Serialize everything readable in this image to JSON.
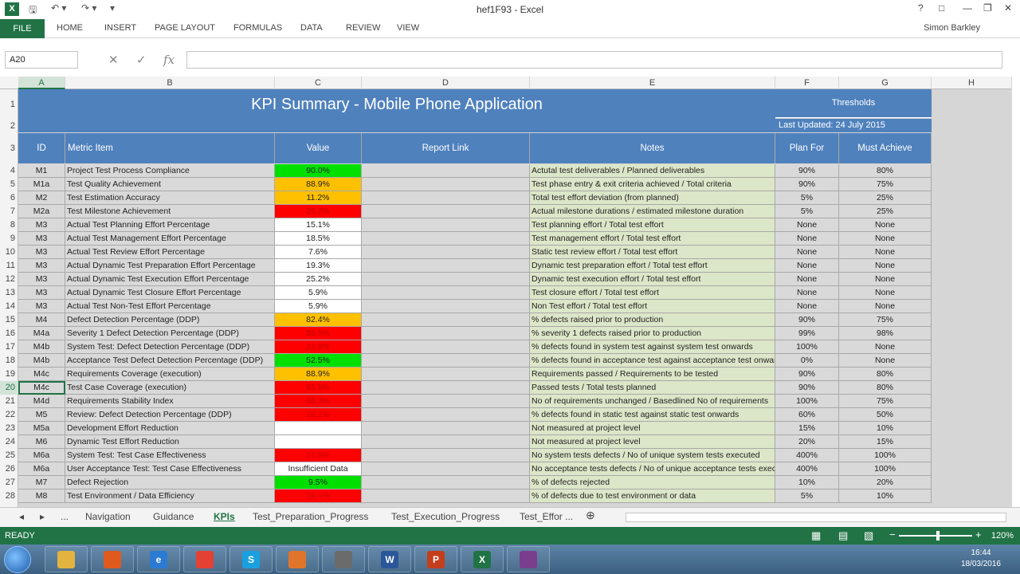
{
  "app": {
    "title": "hef1F93 - Excel",
    "user": "Simon Barkley",
    "help": "?",
    "logo": "X"
  },
  "ribbon": {
    "tabs": [
      "FILE",
      "HOME",
      "INSERT",
      "PAGE LAYOUT",
      "FORMULAS",
      "DATA",
      "REVIEW",
      "VIEW"
    ]
  },
  "formula_bar": {
    "name_box": "A20",
    "fx": "fx",
    "formula": ""
  },
  "columns": [
    "A",
    "B",
    "C",
    "D",
    "E",
    "F",
    "G",
    "H"
  ],
  "sheet_header": {
    "title": "KPI Summary - Mobile Phone Application",
    "thresholds": "Thresholds",
    "last_updated": "Last Updated:  24 July 2015",
    "col_id": "ID",
    "col_metric": "Metric Item",
    "col_value": "Value",
    "col_link": "Report Link",
    "col_notes": "Notes",
    "col_plan": "Plan For",
    "col_must": "Must Achieve"
  },
  "rows": [
    {
      "n": "4",
      "id": "M1",
      "metric": "Project Test Process Compliance",
      "value": "90.0%",
      "status": "green",
      "notes": "Actutal test deliverables / Planned deliverables",
      "plan": "90%",
      "must": "80%"
    },
    {
      "n": "5",
      "id": "M1a",
      "metric": "Test Quality Achievement",
      "value": "88.9%",
      "status": "amber",
      "notes": "Test phase entry & exit criteria achieved / Total criteria",
      "plan": "90%",
      "must": "75%"
    },
    {
      "n": "6",
      "id": "M2",
      "metric": "Test Estimation Accuracy",
      "value": "11.2%",
      "status": "amber",
      "notes": "Total test effort deviation (from planned)",
      "plan": "5%",
      "must": "25%"
    },
    {
      "n": "7",
      "id": "M2a",
      "metric": "Test Milestone Achievement",
      "value": "29.2%",
      "status": "red",
      "notes": "Actual milestone durations / estimated milestone duration",
      "plan": "5%",
      "must": "25%"
    },
    {
      "n": "8",
      "id": "M3",
      "metric": "Actual Test Planning Effort Percentage",
      "value": "15.1%",
      "status": "none",
      "notes": "Test planning effort / Total test effort",
      "plan": "None",
      "must": "None"
    },
    {
      "n": "9",
      "id": "M3",
      "metric": "Actual Test Management Effort Percentage",
      "value": "18.5%",
      "status": "none",
      "notes": "Test management effort / Total test effort",
      "plan": "None",
      "must": "None"
    },
    {
      "n": "10",
      "id": "M3",
      "metric": "Actual Test Review Effort Percentage",
      "value": "7.6%",
      "status": "none",
      "notes": "Static test review effort / Total test effort",
      "plan": "None",
      "must": "None"
    },
    {
      "n": "11",
      "id": "M3",
      "metric": "Actual Dynamic Test Preparation Effort Percentage",
      "value": "19.3%",
      "status": "none",
      "notes": "Dynamic test preparation effort / Total test effort",
      "plan": "None",
      "must": "None"
    },
    {
      "n": "12",
      "id": "M3",
      "metric": "Actual Dynamic Test Execution Effort Percentage",
      "value": "25.2%",
      "status": "none",
      "notes": "Dynamic test execution effort / Total test effort",
      "plan": "None",
      "must": "None"
    },
    {
      "n": "13",
      "id": "M3",
      "metric": "Actual Dynamic Test Closure Effort Percentage",
      "value": "5.9%",
      "status": "none",
      "notes": "Test closure effort / Total test effort",
      "plan": "None",
      "must": "None"
    },
    {
      "n": "14",
      "id": "M3",
      "metric": "Actual Test Non-Test Effort Percentage",
      "value": "5.9%",
      "status": "none",
      "notes": "Non Test effort / Total test effort",
      "plan": "None",
      "must": "None"
    },
    {
      "n": "15",
      "id": "M4",
      "metric": "Defect Detection Percentage (DDP)",
      "value": "82.4%",
      "status": "amber",
      "notes": "% defects raised prior to production",
      "plan": "90%",
      "must": "75%"
    },
    {
      "n": "16",
      "id": "M4a",
      "metric": "Severity 1 Defect Detection Percentage (DDP)",
      "value": "88.9%",
      "status": "red",
      "notes": "% severity 1 defects raised prior to production",
      "plan": "99%",
      "must": "98%"
    },
    {
      "n": "17",
      "id": "M4b",
      "metric": "System Test: Defect Detection Percentage (DDP)",
      "value": "23.9%",
      "status": "red",
      "notes": "% defects found in system test against system test onwards",
      "plan": "100%",
      "must": "None"
    },
    {
      "n": "18",
      "id": "M4b",
      "metric": "Acceptance Test Defect Detection Percentage (DDP)",
      "value": "52.5%",
      "status": "green",
      "notes": "% defects found in acceptance test against acceptance test onwards",
      "plan": "0%",
      "must": "None"
    },
    {
      "n": "19",
      "id": "M4c",
      "metric": "Requirements Coverage (execution)",
      "value": "88.9%",
      "status": "amber",
      "notes": "Requirements passed / Requirements to be tested",
      "plan": "90%",
      "must": "80%"
    },
    {
      "n": "20",
      "id": "M4c",
      "metric": "Test Case Coverage (execution)",
      "value": "65.5%",
      "status": "red",
      "notes": "Passed tests / Total tests planned",
      "plan": "90%",
      "must": "80%"
    },
    {
      "n": "21",
      "id": "M4d",
      "metric": "Requirements Stability Index",
      "value": "68.3%",
      "status": "red",
      "notes": "No of requirements unchanged / Basedlined No of requirements",
      "plan": "100%",
      "must": "75%"
    },
    {
      "n": "22",
      "id": "M5",
      "metric": "Review: Defect Detection Percentage (DDP)",
      "value": "18.1%",
      "status": "red",
      "notes": "% defects found in static test against static test onwards",
      "plan": "60%",
      "must": "50%"
    },
    {
      "n": "23",
      "id": "M5a",
      "metric": "Development Effort Reduction",
      "value": "",
      "status": "none",
      "notes": "Not measured at project level",
      "plan": "15%",
      "must": "10%"
    },
    {
      "n": "24",
      "id": "M6",
      "metric": "Dynamic Test Effort Reduction",
      "value": "",
      "status": "none",
      "notes": "Not measured at project level",
      "plan": "20%",
      "must": "15%"
    },
    {
      "n": "25",
      "id": "M6a",
      "metric": "System Test: Test Case Effectiveness",
      "value": "17.8%",
      "status": "red",
      "notes": "No system tests defects / No of unique system tests executed",
      "plan": "400%",
      "must": "100%"
    },
    {
      "n": "26",
      "id": "M6a",
      "metric": "User Acceptance Test: Test Case Effectiveness",
      "value": "Insufficient Data",
      "status": "none",
      "notes": "No acceptance tests defects / No of unique acceptance tests executed",
      "plan": "400%",
      "must": "100%"
    },
    {
      "n": "27",
      "id": "M7",
      "metric": "Defect Rejection",
      "value": "9.5%",
      "status": "green",
      "notes": "% of defects rejected",
      "plan": "10%",
      "must": "20%"
    },
    {
      "n": "28",
      "id": "M8",
      "metric": "Test Environment / Data Efficiency",
      "value": "24.1%",
      "status": "red",
      "notes": "% of defects due to test environment or data",
      "plan": "5%",
      "must": "10%"
    }
  ],
  "status_colors": {
    "green": "#00e000",
    "amber": "#ffc000",
    "red": "#ff0000",
    "none": "#ffffff"
  },
  "sheet_tabs": [
    "Navigation",
    "Guidance",
    "KPIs",
    "Test_Preparation_Progress",
    "Test_Execution_Progress",
    "Test_Effor ..."
  ],
  "active_sheet": "KPIs",
  "nav_ellipsis": "...",
  "status": {
    "text": "READY",
    "zoom": "120%"
  },
  "clock": {
    "time": "16:44",
    "date": "18/03/2016"
  },
  "taskbar_apps": [
    "explorer-icon",
    "media-player-icon",
    "ie-icon",
    "chrome-icon",
    "skype-icon",
    "outlook-icon",
    "pen-icon",
    "word-icon",
    "powerpoint-icon",
    "excel-icon",
    "teams-icon"
  ]
}
